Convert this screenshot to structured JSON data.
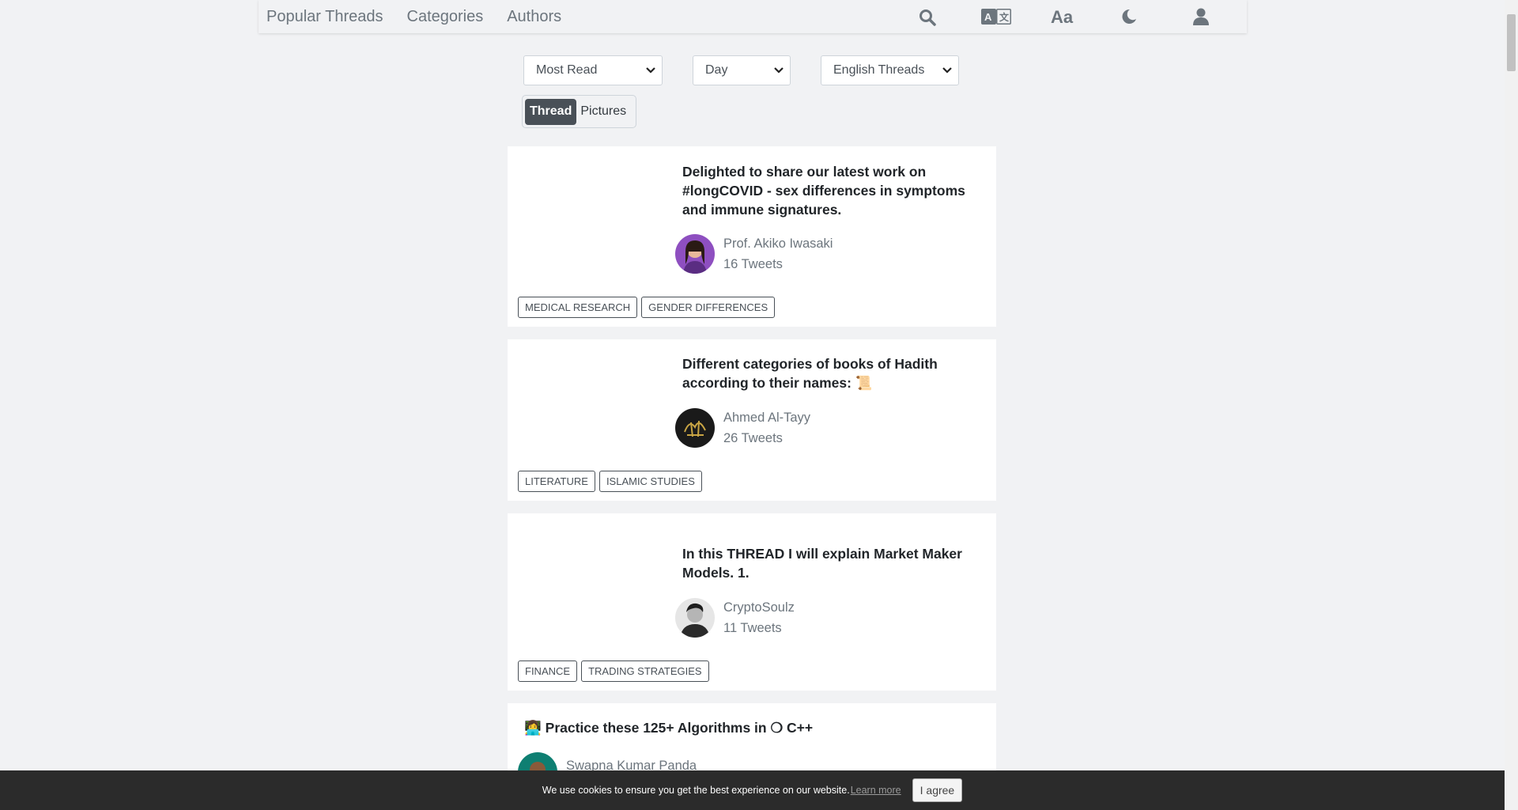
{
  "nav": {
    "links": [
      "Popular Threads",
      "Categories",
      "Authors"
    ],
    "icons": [
      "search-icon",
      "translate-icon",
      "font-size-icon",
      "dark-mode-icon",
      "user-icon"
    ]
  },
  "filters": {
    "sort": "Most Read",
    "period": "Day",
    "language": "English Threads"
  },
  "view_toggle": {
    "active": "Thread",
    "inactive": "Pictures"
  },
  "threads": [
    {
      "title": "Delighted to share our latest work on #longCOVID - sex differences in symptoms and immune signatures.",
      "author": "Prof. Akiko Iwasaki",
      "tweets": "16 Tweets",
      "tags": [
        "MEDICAL RESEARCH",
        "GENDER DIFFERENCES"
      ]
    },
    {
      "title": "Different categories of books of Hadith according to their names: 📜",
      "author": "Ahmed Al-Tayy",
      "tweets": "26 Tweets",
      "tags": [
        "LITERATURE",
        "ISLAMIC STUDIES"
      ]
    },
    {
      "title": "In this THREAD I will explain Market Maker Models. 1.",
      "author": "CryptoSoulz",
      "tweets": "11 Tweets",
      "tags": [
        "FINANCE",
        "TRADING STRATEGIES"
      ]
    },
    {
      "title": "👩‍💻 Practice these 125+ Algorithms in ❍ C++",
      "author": "Swapna Kumar Panda"
    }
  ],
  "cookie": {
    "text": "We use cookies to ensure you get the best experience on our website.",
    "link": "Learn more",
    "button": "I agree"
  }
}
